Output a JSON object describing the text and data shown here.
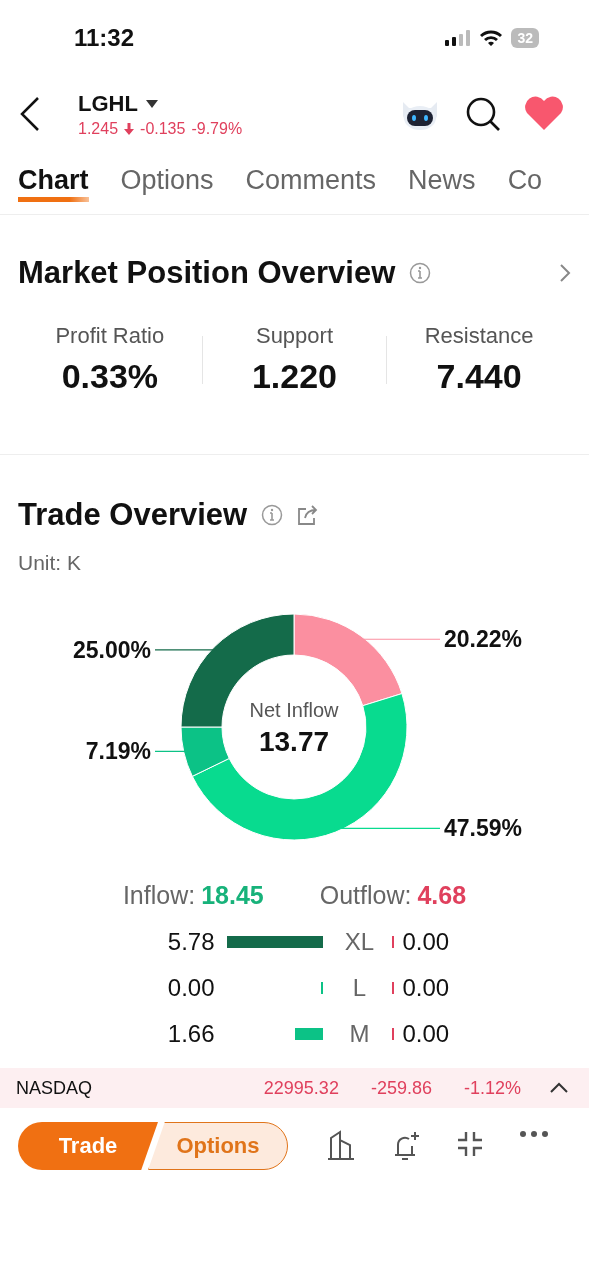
{
  "status_bar": {
    "time": "11:32",
    "battery": "32"
  },
  "header": {
    "symbol": "LGHL",
    "price": "1.245",
    "change": "-0.135",
    "change_pct": "-9.79%"
  },
  "tabs": [
    {
      "label": "Chart",
      "selected": true
    },
    {
      "label": "Options",
      "selected": false
    },
    {
      "label": "Comments",
      "selected": false
    },
    {
      "label": "News",
      "selected": false
    },
    {
      "label": "Co",
      "selected": false
    }
  ],
  "market_position": {
    "title": "Market Position Overview",
    "stats": [
      {
        "label": "Profit Ratio",
        "value": "0.33%"
      },
      {
        "label": "Support",
        "value": "1.220"
      },
      {
        "label": "Resistance",
        "value": "7.440"
      }
    ]
  },
  "trade_overview": {
    "title": "Trade Overview",
    "unit": "Unit: K",
    "center_label": "Net Inflow",
    "center_value": "13.77",
    "chart_data": {
      "type": "donut",
      "values": [
        20.22,
        47.59,
        7.19,
        25.0
      ],
      "value_labels": [
        "20.22%",
        "47.59%",
        "7.19%",
        "25.00%"
      ]
    },
    "inflow_label": "Inflow:",
    "inflow_value": "18.45",
    "outflow_label": "Outflow:",
    "outflow_value": "4.68",
    "rows": [
      {
        "size": "XL",
        "inflow": "5.78",
        "outflow": "0.00"
      },
      {
        "size": "L",
        "inflow": "0.00",
        "outflow": "0.00"
      },
      {
        "size": "M",
        "inflow": "1.66",
        "outflow": "0.00"
      }
    ]
  },
  "index_bar": {
    "name": "NASDAQ",
    "value": "22995.32",
    "change": "-259.86",
    "change_pct": "-1.12%"
  },
  "bottom_bar": {
    "trade": "Trade",
    "options": "Options"
  }
}
